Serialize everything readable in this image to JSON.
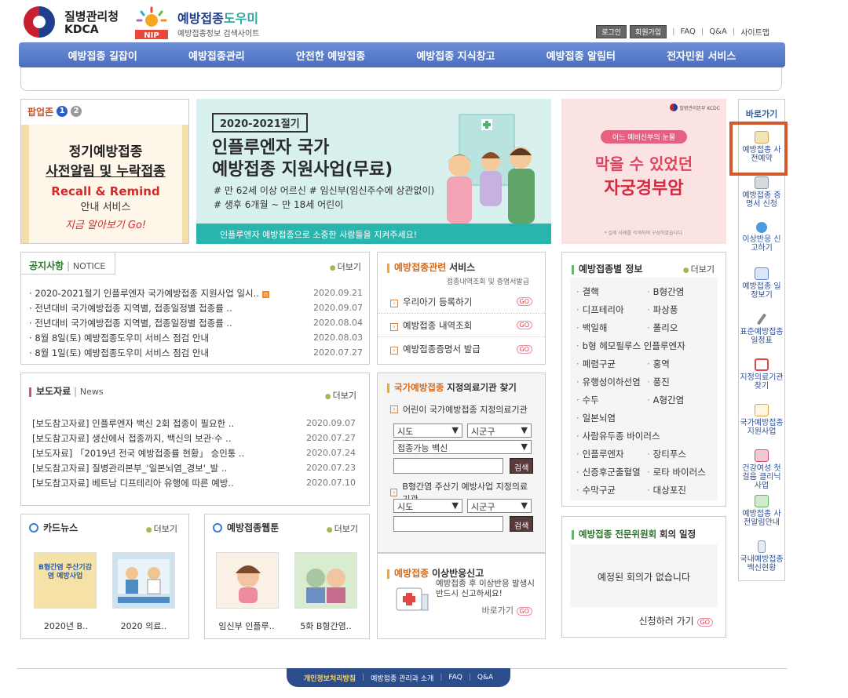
{
  "header": {
    "kdca_title": "질병관리청",
    "kdca_sub": "KDCA",
    "nip_title_a": "예방접종",
    "nip_title_b": "도우미",
    "nip_sub": "예방접종정보 검색사이트",
    "nip_badge": "NIP",
    "login": "로그인",
    "join": "회원가입",
    "links": [
      "FAQ",
      "Q&A",
      "사이트맵"
    ]
  },
  "gnb": [
    "예방접종 길잡이",
    "예방접종관리",
    "안전한 예방접종",
    "예방접종 지식창고",
    "예방접종 알림터",
    "전자민원 서비스"
  ],
  "popup": {
    "label": "팝업존",
    "pages": [
      "1",
      "2"
    ],
    "line1": "정기예방접종",
    "line2": "사전알림 및 누락접종",
    "line3": "Recall & Remind",
    "line4": "안내 서비스",
    "line5": "지금 알아보기 Go!"
  },
  "banner1": {
    "tag": "2020-2021절기",
    "title1": "인플루엔자 국가",
    "title2": "예방접종 지원사업(무료)",
    "line1": "# 만 62세 이상 어르신 # 임신부(임신주수에 상관없이)",
    "line2": "# 생후 6개월 ~ 만 18세 어린이",
    "footer": "인플루엔자 예방접종으로 소중한 사람들을 지켜주세요!"
  },
  "banner2": {
    "pill": "어느 예비신부의 눈물",
    "title1": "막을 수 있었던",
    "title2": "자궁경부암",
    "note": "* 실제 사례를 각색하여 구성하였습니다.",
    "logo_text": "질병관리본부 KCDC"
  },
  "quick": {
    "title": "바로가기",
    "items": [
      {
        "label": "예방접종 사전예약",
        "icon": "calendar-icon",
        "color": "#e9c46a"
      },
      {
        "label": "예방접종 증명서 신청",
        "icon": "printer-icon",
        "color": "#9aa5b1"
      },
      {
        "label": "이상반응 신고하기",
        "icon": "check-circle-icon",
        "color": "#4a9be0"
      },
      {
        "label": "예방접종 일정보기",
        "icon": "schedule-icon",
        "color": "#5b8bd6"
      },
      {
        "label": "표준예방접종 일정표",
        "icon": "syringe-icon",
        "color": "#888888"
      },
      {
        "label": "지정의료기관 찾기",
        "icon": "hospital-icon",
        "color": "#e04848"
      },
      {
        "label": "국가예방접종 지원사업",
        "icon": "document-icon",
        "color": "#d9a441"
      },
      {
        "label": "건강여성 첫걸음 클리닉사업",
        "icon": "medkit-icon",
        "color": "#c94f6d"
      },
      {
        "label": "예방접종 사전알림안내",
        "icon": "speaker-icon",
        "color": "#5cb85c"
      },
      {
        "label": "국내예방접종 백신현황",
        "icon": "vaccine-icon",
        "color": "#8aa0b8"
      }
    ]
  },
  "notice": {
    "tab": "공지사항",
    "tab_en": "NOTICE",
    "more": "더보기",
    "new_badge": "n",
    "rows": [
      {
        "title": "2020-2021절기 인플루엔자 국가예방접종 지원사업 일시..",
        "date": "2020.09.21",
        "new": true
      },
      {
        "title": "전년대비 국가예방접종 지역별, 접종일정별 접종률 ..",
        "date": "2020.09.07",
        "new": false
      },
      {
        "title": "전년대비 국가예방접종 지역별, 접종일정별 접종률 ..",
        "date": "2020.08.04",
        "new": false
      },
      {
        "title": "8월 8일(토) 예방접종도우미 서비스 점검 안내",
        "date": "2020.08.03",
        "new": false
      },
      {
        "title": "8월 1일(토) 예방접종도우미 서비스 점검 안내",
        "date": "2020.07.27",
        "new": false
      }
    ]
  },
  "press": {
    "tab": "보도자료",
    "tab_en": "News",
    "more": "더보기",
    "rows": [
      {
        "title": "[보도참고자료] 인플루엔자 백신 2회 접종이 필요한 ..",
        "date": "2020.09.07"
      },
      {
        "title": "[보도참고자료] 생산에서 접종까지, 백신의 보관·수 ..",
        "date": "2020.07.27"
      },
      {
        "title": "[보도자료] 「2019년 전국 예방접종률 현황」 승인통 ..",
        "date": "2020.07.24"
      },
      {
        "title": "[보도참고자료] 질병관리본부_'일본뇌염_경보'_발 ..",
        "date": "2020.07.23"
      },
      {
        "title": "[보도참고자료] 베트남 디프테리아 유행에 따른 예방..",
        "date": "2020.07.10"
      }
    ]
  },
  "cardnews": {
    "title": "카드뉴스",
    "more": "더보기",
    "items": [
      "2020년 B..",
      "2020 의료.."
    ],
    "thumb1_text": "B형간염 주산기감염 예방사업"
  },
  "webtoon": {
    "title": "예방접종웹툰",
    "more": "더보기",
    "items": [
      "임신부 인플루..",
      "5화 B형간염.."
    ]
  },
  "service": {
    "title_a": "예방접종관련",
    "title_b": "서비스",
    "sub": "접종내역조회 및 증명서발급",
    "go": "GO",
    "rows": [
      "우리아기 등록하기",
      "예방접종 내역조회",
      "예방접종증명서 발급"
    ]
  },
  "hospital": {
    "title_a": "국가예방접종",
    "title_b": "지정의료기관 찾기",
    "sub1": "어린이 국가예방접종 지정의료기관",
    "sido": "시도",
    "sigungu": "시군구",
    "vaccine": "접종가능 백신",
    "search": "검색",
    "sub2": "B형간염 주산기 예방사업 지정의료기관"
  },
  "adverse": {
    "title_a": "예방접종",
    "title_b": "이상반응신고",
    "text1": "예방접종 후 이상반응 발생시",
    "text2": "반드시 신고하세요!",
    "link": "바로가기",
    "go": "GO"
  },
  "info": {
    "title": "예방접종별 정보",
    "more": "더보기",
    "rows": [
      [
        "결핵",
        "B형간염"
      ],
      [
        "디프테리아",
        "파상풍"
      ],
      [
        "백일해",
        "폴리오"
      ],
      [
        "b형 헤모필루스 인플루엔자",
        ""
      ],
      [
        "폐렴구균",
        "홍역"
      ],
      [
        "유행성이하선염",
        "풍진"
      ],
      [
        "수두",
        "A형간염"
      ],
      [
        "일본뇌염",
        ""
      ],
      [
        "사람유두종 바이러스",
        ""
      ],
      [
        "인플루엔자",
        "장티푸스"
      ],
      [
        "신증후군출혈열",
        "로타 바이러스"
      ],
      [
        "수막구균",
        "대상포진"
      ]
    ]
  },
  "committee": {
    "title_a": "예방접종 전문위원회",
    "title_b": "회의 일정",
    "empty": "예정된 회의가 없습니다",
    "link": "신청하러 가기",
    "go": "GO"
  },
  "footer": [
    "개인정보처리방침",
    "예방접종 관리과 소개",
    "FAQ",
    "Q&A"
  ],
  "colors": {
    "gnb": "#5a7fcc",
    "accent": "#d84e1f",
    "teal": "#28b5ad",
    "footer": "#2b4d8c"
  }
}
